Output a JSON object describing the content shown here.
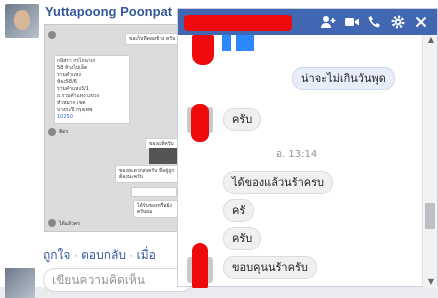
{
  "feed": {
    "author": "Yuttapoong Poonpat",
    "actions": [
      {
        "label": "ถูกใจ"
      },
      {
        "label": "ตอบกลับ"
      },
      {
        "label": "เมื่อ"
      }
    ],
    "separator": "·",
    "comment_placeholder": "เขียนความคิดเห็น",
    "photo": {
      "card_lines": [
        "กลิสรา กรไกนาเก",
        "58 ห้วงไปเล็ต",
        "รามคำแหง",
        "ห้อง58/6",
        "รามคำแหง3/1",
        "ถ.รามคำแหง แขวง",
        "หัวหมาก เขต",
        "บางกะปิ กรุงเทพ",
        "10250"
      ],
      "bubble_1": "ขอเก็บที่ดอยช้าง ครับ",
      "label_1": "ติดร",
      "bubble_2": "ของแท้ครับ",
      "bubble_3": "ของสะดวกส่งครับ ที่อยู่ถูกต้องนะครับ",
      "bubble_4": "ได้รับของหรือยัง ครับผม",
      "label_2": "ได้แล้วคร"
    }
  },
  "chat": {
    "header_icons": [
      "add-people",
      "video-call",
      "phone-call",
      "settings",
      "close"
    ],
    "messages": [
      {
        "text": "น่าจะไม่เกินวันพุด",
        "direction": "out"
      },
      {
        "text": "ครับ",
        "direction": "in"
      },
      {
        "text": "อ. 13:14",
        "direction": "timestamp"
      },
      {
        "text": "ได้ของแล้วนร้าครบ",
        "direction": "in"
      },
      {
        "text": "ครั",
        "direction": "in"
      },
      {
        "text": "ครับ",
        "direction": "in"
      },
      {
        "text": "ขอบคุนนร้าครับ",
        "direction": "in"
      }
    ]
  }
}
